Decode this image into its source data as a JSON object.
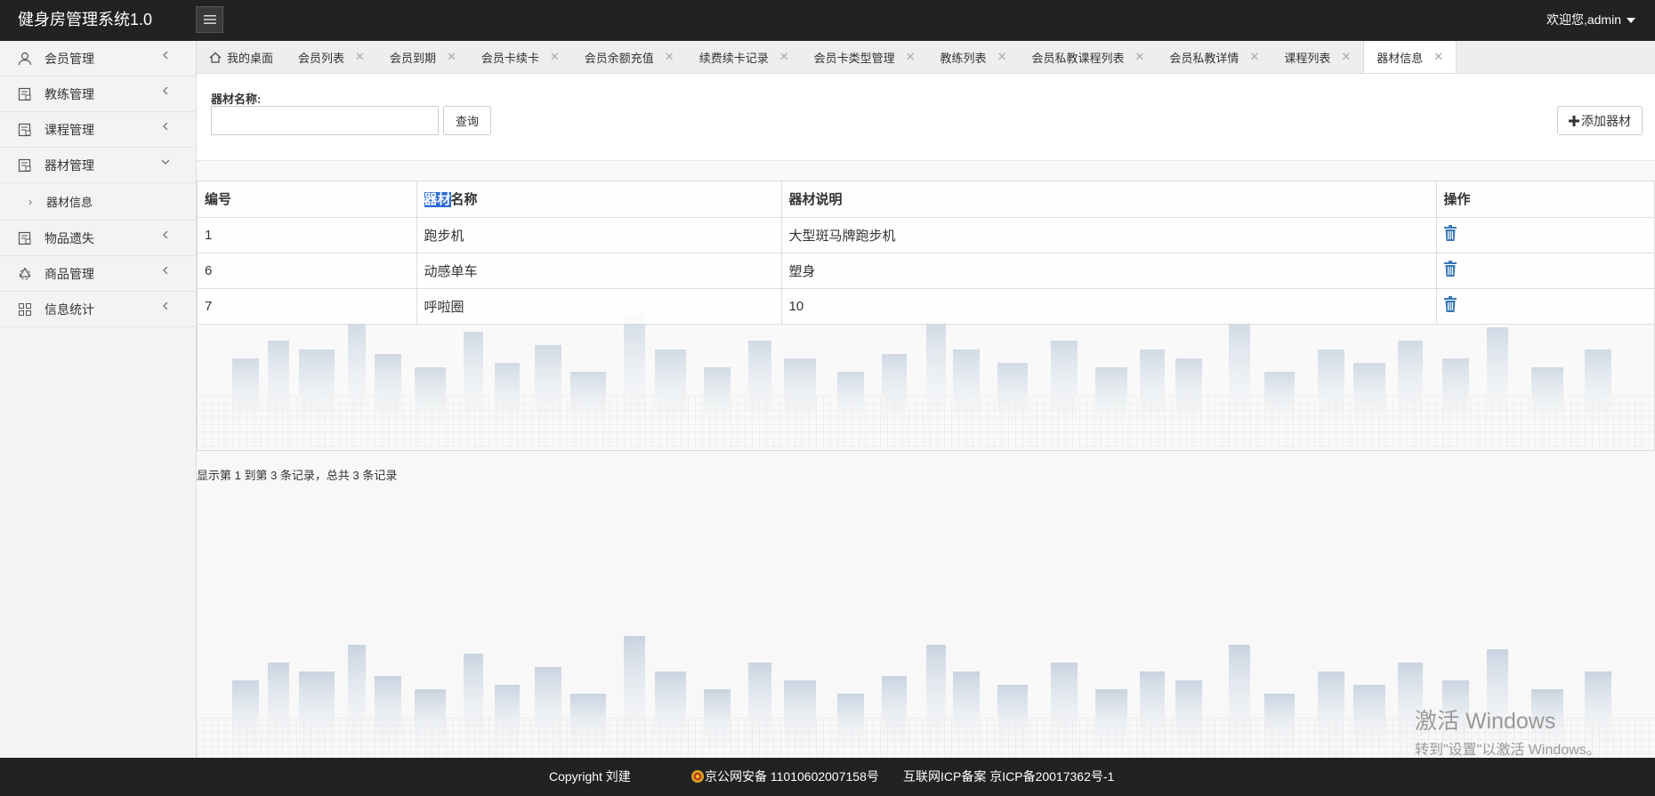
{
  "header": {
    "app_title": "健身房管理系统1.0",
    "user_menu": "欢迎您,admin"
  },
  "sidebar": {
    "items": [
      {
        "label": "会员管理",
        "icon": "user-icon"
      },
      {
        "label": "教练管理",
        "icon": "doc-icon"
      },
      {
        "label": "课程管理",
        "icon": "doc-icon"
      },
      {
        "label": "器材管理",
        "icon": "doc-icon",
        "expanded": true,
        "sub": [
          "器材信息"
        ]
      },
      {
        "label": "物品遗失",
        "icon": "doc-icon"
      },
      {
        "label": "商品管理",
        "icon": "recycle-icon"
      },
      {
        "label": "信息统计",
        "icon": "grid-icon"
      }
    ]
  },
  "tabs": [
    {
      "label": "我的桌面",
      "home": true
    },
    {
      "label": "会员列表"
    },
    {
      "label": "会员到期"
    },
    {
      "label": "会员卡续卡"
    },
    {
      "label": "会员余额充值"
    },
    {
      "label": "续费续卡记录"
    },
    {
      "label": "会员卡类型管理"
    },
    {
      "label": "教练列表"
    },
    {
      "label": "会员私教课程列表"
    },
    {
      "label": "会员私教详情"
    },
    {
      "label": "课程列表"
    },
    {
      "label": "器材信息",
      "active": true
    }
  ],
  "search": {
    "label": "器材名称:",
    "value": "",
    "query_button": "查询",
    "add_button": "添加器材"
  },
  "table": {
    "headers": {
      "id": "编号",
      "name_highlight": "器材",
      "name_rest": "名称",
      "desc": "器材说明",
      "ops": "操作"
    },
    "rows": [
      {
        "id": "1",
        "name": "跑步机",
        "desc": "大型斑马牌跑步机"
      },
      {
        "id": "6",
        "name": "动感单车",
        "desc": "塑身"
      },
      {
        "id": "7",
        "name": "呼啦圈",
        "desc": "10"
      }
    ]
  },
  "pager": {
    "info": "显示第 1 到第 3 条记录，总共 3 条记录"
  },
  "activate": {
    "line1": "激活 Windows",
    "line2": "转到\"设置\"以激活 Windows。"
  },
  "footer": {
    "copyright": "Copyright 刘建",
    "police": "京公网安备 11010602007158号",
    "icp": "互联网ICP备案 京ICP备20017362号-1"
  },
  "colors": {
    "header_bg": "#222222",
    "highlight": "#2b6bd1",
    "trash": "#3a78b8"
  }
}
